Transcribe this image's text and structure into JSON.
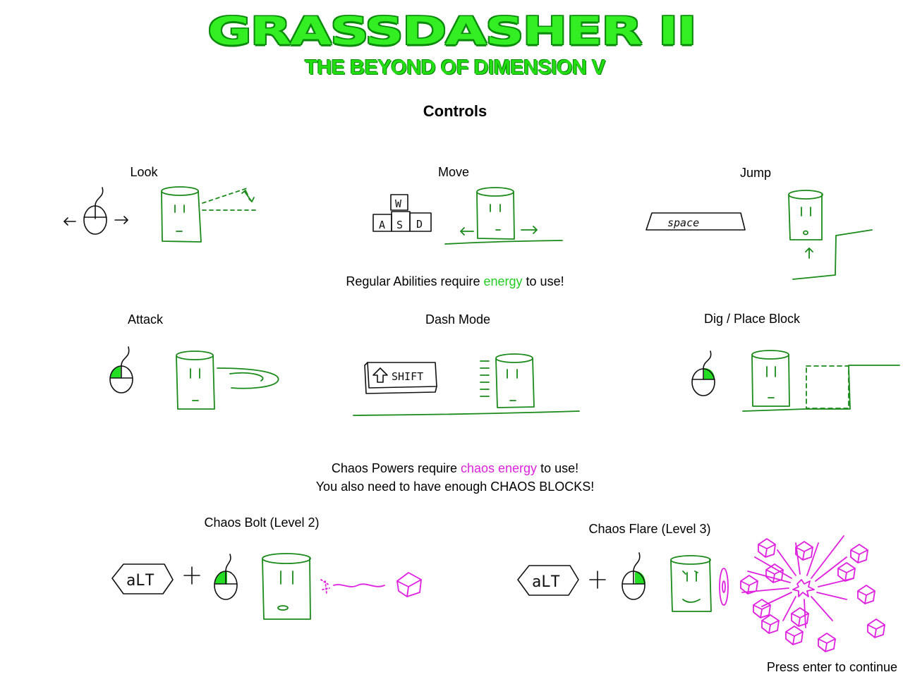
{
  "header": {
    "title": "GRASSDASHER II",
    "subtitle": "THE BEYOND OF DIMENSION V",
    "controls_heading": "Controls"
  },
  "controls": {
    "look": "Look",
    "move": "Move",
    "jump": "Jump",
    "attack": "Attack",
    "dash_mode": "Dash Mode",
    "dig_place": "Dig / Place Block",
    "chaos_bolt": "Chaos Bolt (Level 2)",
    "chaos_flare": "Chaos Flare (Level 3)"
  },
  "keys": {
    "w": "W",
    "a": "A",
    "s": "S",
    "d": "D",
    "space": "space",
    "shift": "SHIFT",
    "alt": "aLT"
  },
  "notes": {
    "regular_before": "Regular Abilities require ",
    "regular_highlight": "energy",
    "regular_after": " to use!",
    "chaos_before": "Chaos Powers require ",
    "chaos_highlight": "chaos energy",
    "chaos_after": " to use!",
    "chaos_line2": "You also need to have enough CHAOS BLOCKS!"
  },
  "footer": {
    "continue": "Press enter to continue"
  },
  "colors": {
    "title_green": "#33ee22",
    "energy_green": "#22cc22",
    "chaos_magenta": "#dd22dd",
    "character_green": "#1a8a1a"
  },
  "icons": [
    "mouse-icon",
    "left-mouse-button-icon",
    "right-mouse-button-icon",
    "character-icon",
    "chaos-block-icon",
    "chaos-burst-icon"
  ]
}
